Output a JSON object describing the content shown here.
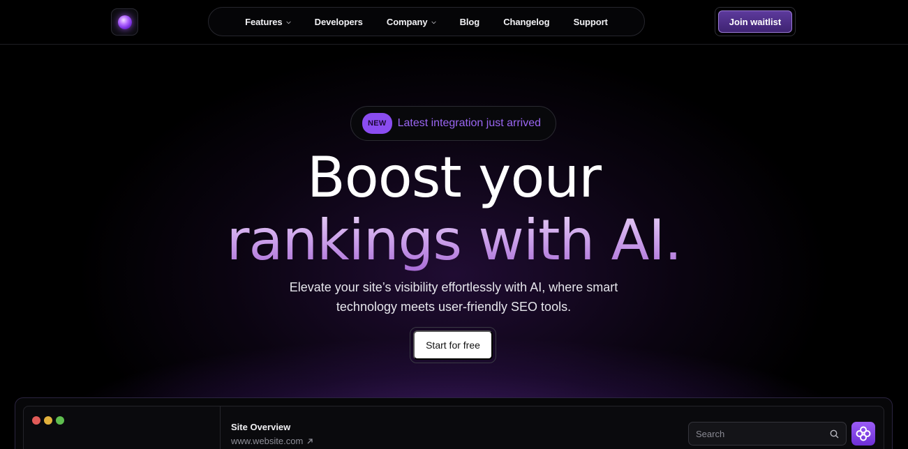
{
  "header": {
    "logo_icon": "orb-logo-icon",
    "nav": [
      {
        "label": "Features",
        "has_dropdown": true
      },
      {
        "label": "Developers",
        "has_dropdown": false
      },
      {
        "label": "Company",
        "has_dropdown": true
      },
      {
        "label": "Blog",
        "has_dropdown": false
      },
      {
        "label": "Changelog",
        "has_dropdown": false
      },
      {
        "label": "Support",
        "has_dropdown": false
      }
    ],
    "cta_label": "Join waitlist"
  },
  "hero": {
    "badge": "NEW",
    "announcement": "Latest integration just arrived",
    "headline_line1": "Boost your",
    "headline_line2": "rankings with AI.",
    "subtitle_line1": "Elevate your site’s visibility effortlessly with AI, where smart",
    "subtitle_line2": "technology meets user-friendly SEO tools.",
    "cta_label": "Start for free"
  },
  "preview": {
    "window_dots": [
      "#e15b58",
      "#e2b13c",
      "#5fbe4f"
    ],
    "title": "Site Overview",
    "url": "www.website.com",
    "search_placeholder": "Search",
    "brand_icon": "flower-logo-icon"
  },
  "colors": {
    "background": "#000000",
    "accent": "#8a4cf0",
    "announcement_text": "#9a66f2",
    "headline_gradient_top": "#e8d2f6",
    "headline_gradient_bottom": "#a96cd6"
  }
}
